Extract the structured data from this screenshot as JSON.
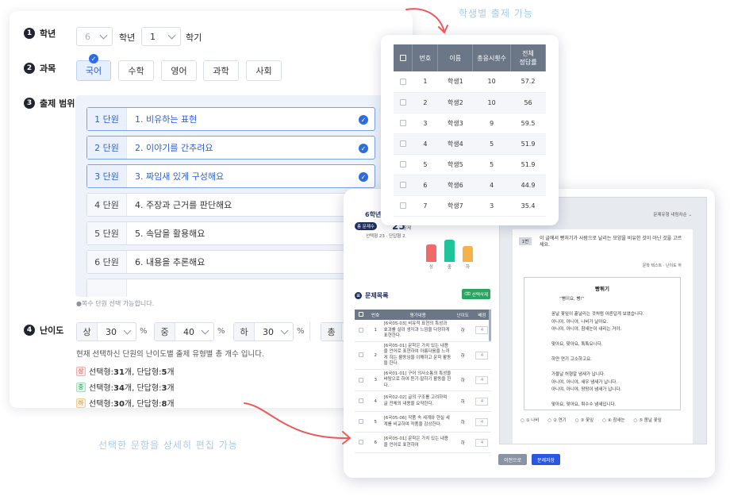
{
  "grade": {
    "label": "학년",
    "grade_value": "6",
    "grade_unit": "학년",
    "semester_value": "1",
    "semester_unit": "학기"
  },
  "subject": {
    "label": "과목",
    "items": [
      "국어",
      "수학",
      "영어",
      "과학",
      "사회"
    ],
    "selected": "국어"
  },
  "range": {
    "label": "출제 범위",
    "units": [
      {
        "no": "1 단원",
        "name": "1. 비유하는 표현",
        "checked": true
      },
      {
        "no": "2 단원",
        "name": "2. 이야기를 간추려요",
        "checked": true
      },
      {
        "no": "3 단원",
        "name": "3. 짜임새 있게 구성해요",
        "checked": true
      },
      {
        "no": "4 단원",
        "name": "4. 주장과 근거를 판단해요",
        "checked": false
      },
      {
        "no": "5 단원",
        "name": "5. 속담을 활용해요",
        "checked": false
      },
      {
        "no": "6 단원",
        "name": "6. 내용을 추론해요",
        "checked": false
      }
    ],
    "note": "●복수 단원 선택 가능합니다."
  },
  "difficulty": {
    "label": "난이도",
    "levels": [
      {
        "name": "상",
        "value": "30"
      },
      {
        "name": "중",
        "value": "40"
      },
      {
        "name": "하",
        "value": "30"
      }
    ],
    "extra_label": "총",
    "percent": "%",
    "description": "현재 선택하신 단원의 난이도별 출제 유형별 총 개수 입니다.",
    "counts": [
      {
        "tag": "상",
        "text_a": "선택형:",
        "a": "31",
        "text_b": "개, 단답형:",
        "b": "5",
        "suffix": "개"
      },
      {
        "tag": "중",
        "text_a": "선택형:",
        "a": "34",
        "text_b": "개, 단답형:",
        "b": "3",
        "suffix": "개"
      },
      {
        "tag": "하",
        "text_a": "선택형:",
        "a": "30",
        "text_b": "개, 단답형:",
        "b": "8",
        "suffix": "개"
      }
    ]
  },
  "students": {
    "headers": [
      "번호",
      "이름",
      "총응시횟수",
      "전체",
      "정답률"
    ],
    "rows": [
      [
        "1",
        "학생1",
        "10",
        "57.2"
      ],
      [
        "2",
        "학생2",
        "10",
        "56"
      ],
      [
        "3",
        "학생3",
        "9",
        "59.5"
      ],
      [
        "4",
        "학생4",
        "5",
        "51.9"
      ],
      [
        "5",
        "학생5",
        "5",
        "51.9"
      ],
      [
        "6",
        "학생6",
        "4",
        "44.9"
      ],
      [
        "7",
        "학생7",
        "3",
        "35.4"
      ]
    ]
  },
  "editor": {
    "grade": "6학년",
    "pill": "총 문제수",
    "total": "25",
    "total_unit": "문제",
    "mini": "선택형 23 · 단답형 2",
    "bars": [
      {
        "label": "상",
        "value": 0.62,
        "color": "#f06a6a"
      },
      {
        "label": "중",
        "value": 0.78,
        "color": "#1fc49a"
      },
      {
        "label": "하",
        "value": 0.55,
        "color": "#f5b14a"
      }
    ],
    "list_title": "문제목록",
    "delete_btn": "선택삭제",
    "q_headers": [
      "번호",
      "평가내용",
      "난이도",
      "배점"
    ],
    "questions": [
      {
        "no": "1",
        "content": "[6국05-03] 비유적 표현의 특성과 효과를 살려 생각과 느낌을 다양하게 표현한다.",
        "level": "하",
        "score": "4"
      },
      {
        "no": "2",
        "content": "[6국05-01] 문학은 가치 있는 내용을 언어로 표현하여 아름다움을 느끼게 하는 활동임을 이해하고 문학 활동을 한다.",
        "level": "하",
        "score": "4"
      },
      {
        "no": "3",
        "content": "[6국01-01] 구어 의사소통의 특성을 바탕으로 하여 듣기·말하기 활동을 한다.",
        "level": "하",
        "score": "4"
      },
      {
        "no": "4",
        "content": "[6국02-02] 글의 구조를 고려하며 글 전체의 내용을 요약한다.",
        "level": "하",
        "score": "4"
      },
      {
        "no": "5",
        "content": "[6국05-06] 작품 속 세계와 현실 세계를 비교하며 작품을 감상한다.",
        "level": "하",
        "score": "4"
      },
      {
        "no": "6",
        "content": "[6국05-01] 문학은 가치 있는 내용을 언어로 표현하여",
        "level": "하",
        "score": "4"
      }
    ],
    "top_right": "문제유형 내림차순",
    "q_no": "1번",
    "q_text": "이 글에서 빵처기가 사람으로 날리는 모양을 비유한 것이 아닌 것을 고르세요.",
    "q_meta": "문학 텍스트 · 난이도 하",
    "passage_title": "빵튀기",
    "passage_lines": [
      "“뻥이요, 뻥!”",
      "",
      "꿈날 꽃잎이 흩날리는 것처럼 아른답게 보였습니다.",
      "아니야, 아니야, 나비가 날아요.",
      "아니야, 아니야, 참새눈이 내리는 거야.",
      "",
      "맞아요, 맞아요, 톡톡요니다.",
      "",
      "하얀 연기 고소하고요.",
      "",
      "가을날 허형알 냄새가 납니다.",
      "아니야, 아니야, 새우 냄새가 납니다.",
      "아니야, 아니야, 땅땅이 냄새가 납니다.",
      "",
      "맞아요, 맞아요, 튀수수 냄새입니다."
    ],
    "choices": [
      "① 나비",
      "② 연기",
      "③ 꽃잎",
      "④ 참새눈",
      "⑤ 봄날 꽃잎"
    ],
    "prev_btn": "이전으로",
    "save_btn": "문제저장"
  },
  "annotations": {
    "top": "학생별 출제 가능",
    "bottom": "선택한 문항을 상세히 편집 가능"
  }
}
